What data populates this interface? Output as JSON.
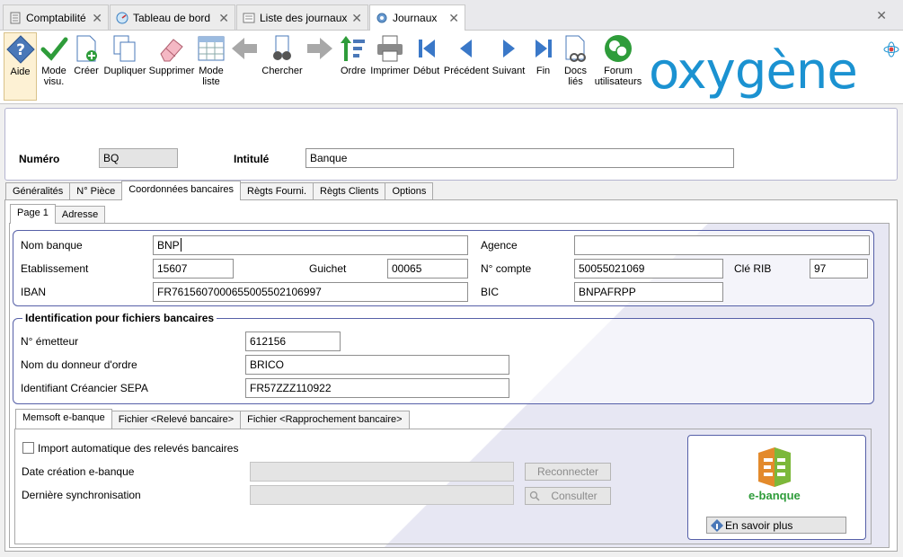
{
  "window_tabs": [
    {
      "label": "Comptabilité",
      "active": false
    },
    {
      "label": "Tableau de bord",
      "active": false
    },
    {
      "label": "Liste des journaux",
      "active": false
    },
    {
      "label": "Journaux",
      "active": true
    }
  ],
  "toolbar": {
    "aide": "Aide",
    "mode_visu_1": "Mode",
    "mode_visu_2": "visu.",
    "creer": "Créer",
    "dupliquer": "Dupliquer",
    "supprimer": "Supprimer",
    "mode_liste_1": "Mode",
    "mode_liste_2": "liste",
    "chercher": "Chercher",
    "ordre": "Ordre",
    "imprimer": "Imprimer",
    "debut": "Début",
    "precedent": "Précédent",
    "suivant": "Suivant",
    "fin": "Fin",
    "docs_1": "Docs",
    "docs_2": "liés",
    "forum_1": "Forum",
    "forum_2": "utilisateurs"
  },
  "logo": "oxygène",
  "header": {
    "numero_label": "Numéro",
    "numero_value": "BQ",
    "intitule_label": "Intitulé",
    "intitule_value": "Banque"
  },
  "main_tabs": [
    "Généralités",
    "N° Pièce",
    "Coordonnées bancaires",
    "Règts Fourni.",
    "Règts Clients",
    "Options"
  ],
  "sub_tabs": [
    "Page 1",
    "Adresse"
  ],
  "bank": {
    "nom_banque_label": "Nom banque",
    "nom_banque_value": "BNP",
    "agence_label": "Agence",
    "agence_value": "",
    "etablissement_label": "Etablissement",
    "etablissement_value": "15607",
    "guichet_label": "Guichet",
    "guichet_value": "00065",
    "compte_label": "N° compte",
    "compte_value": "50055021069",
    "rib_label": "Clé RIB",
    "rib_value": "97",
    "iban_label": "IBAN",
    "iban_value": "FR7615607000655005502106997",
    "bic_label": "BIC",
    "bic_value": "BNPAFRPP"
  },
  "ident": {
    "title": "Identification pour fichiers bancaires",
    "emetteur_label": "N° émetteur",
    "emetteur_value": "612156",
    "donneur_label": "Nom du donneur d'ordre",
    "donneur_value": "BRICO",
    "sepa_label": "Identifiant Créancier SEPA",
    "sepa_value": "FR57ZZZ110922"
  },
  "bottom_tabs": [
    "Memsoft e-banque",
    "Fichier <Relevé bancaire>",
    "Fichier <Rapprochement bancaire>"
  ],
  "ebanque": {
    "import_label": "Import automatique des relevés bancaires",
    "import_checked": false,
    "date_creation_label": "Date création e-banque",
    "date_creation_value": "",
    "derniere_sync_label": "Dernière synchronisation",
    "derniere_sync_value": "",
    "reconnecter": "Reconnecter",
    "consulter": "Consulter",
    "logo_text": "e-banque",
    "en_savoir_plus": "En savoir plus"
  },
  "colors": {
    "accent": "#1b92d1",
    "group_border": "#5660a8",
    "green_icon": "#2e9c3a"
  }
}
